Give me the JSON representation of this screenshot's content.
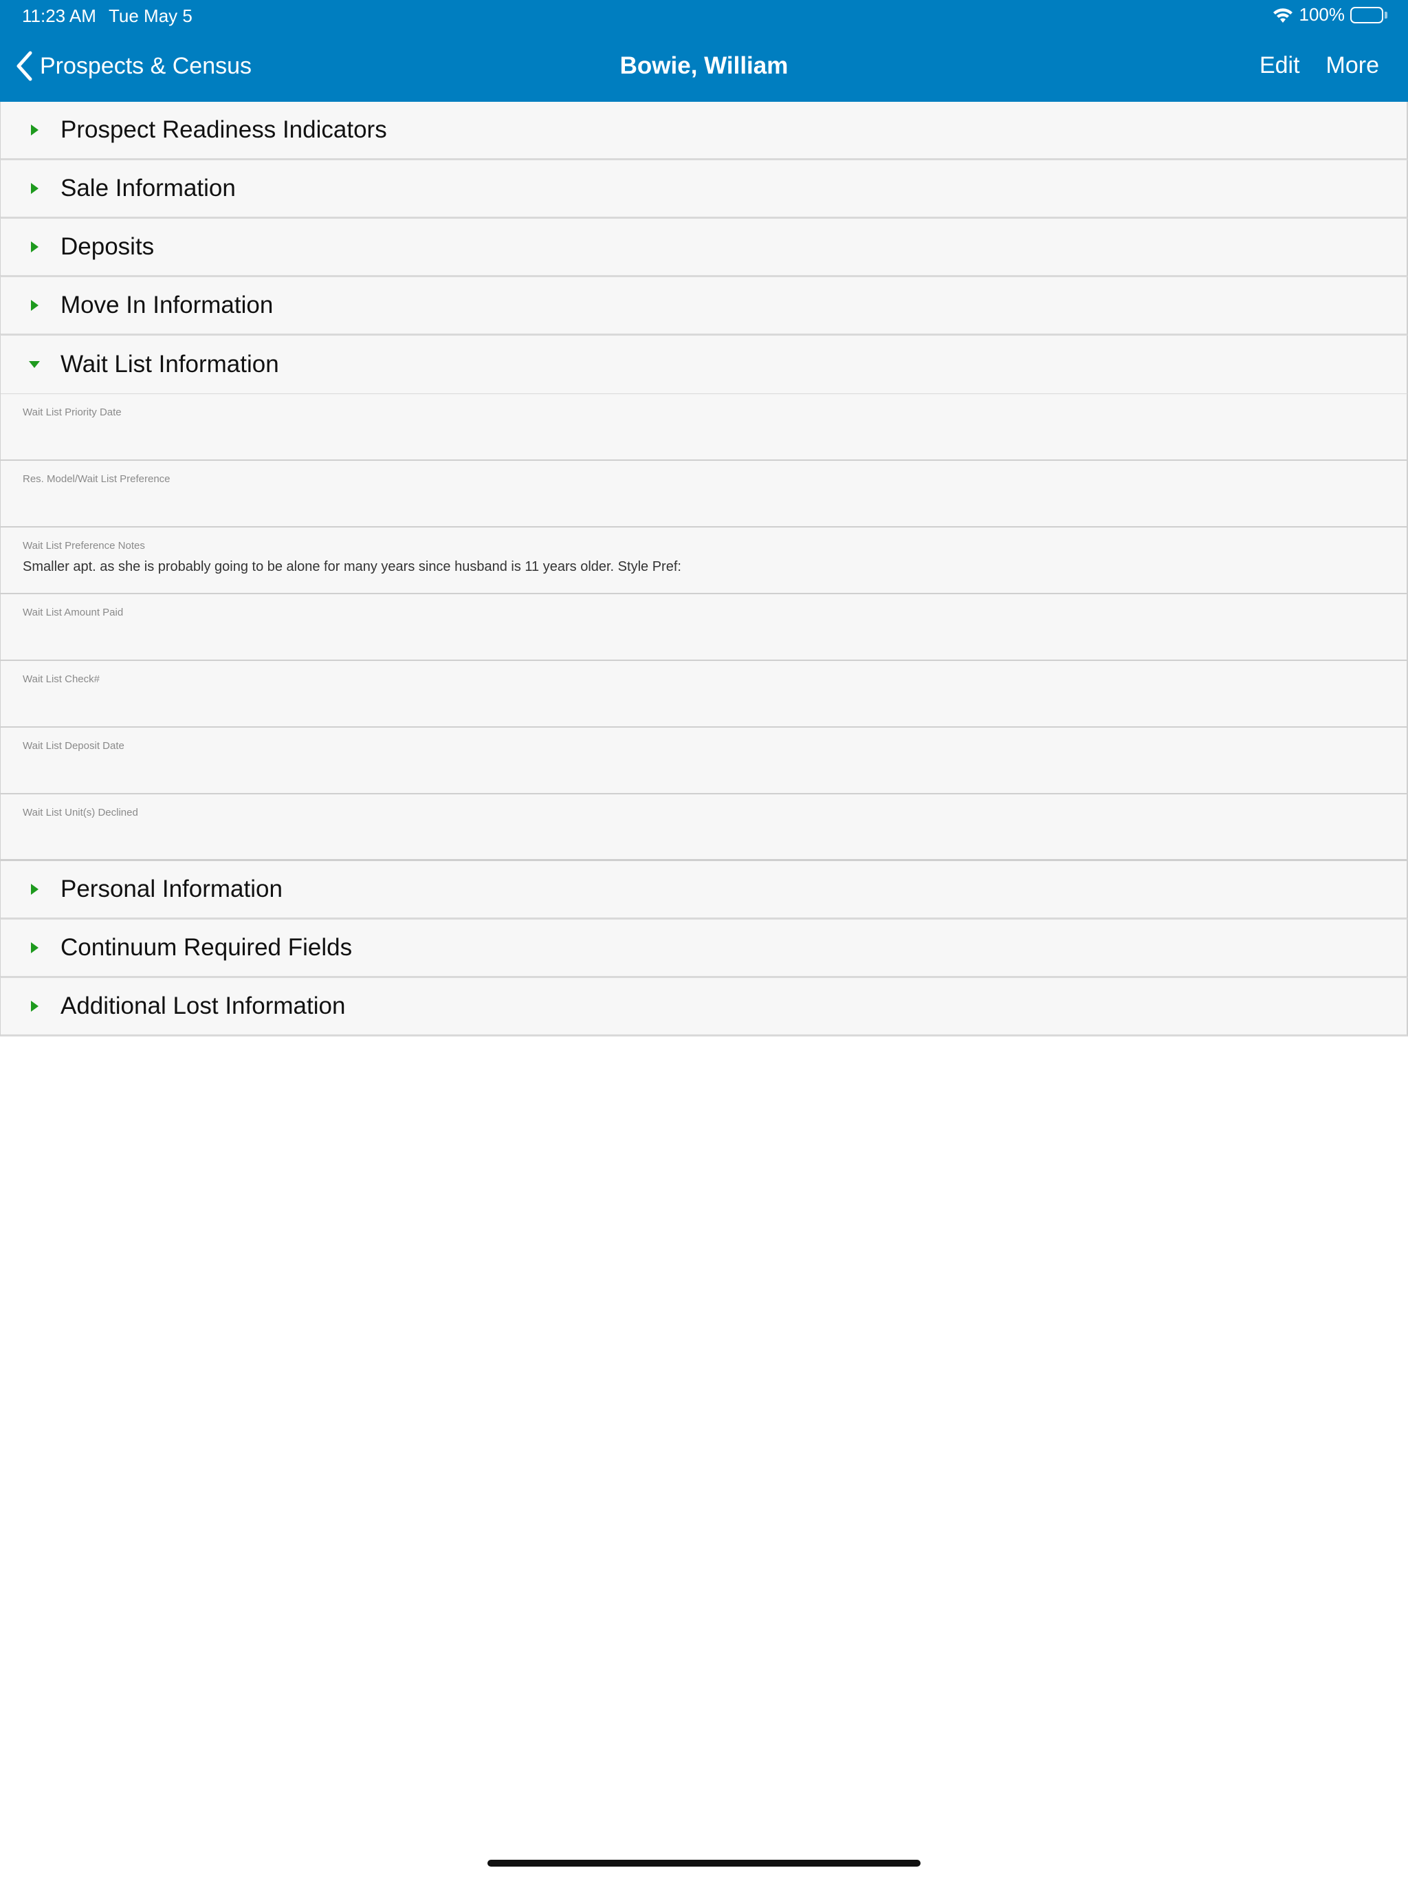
{
  "status_bar": {
    "time": "11:23 AM",
    "date": "Tue May 5",
    "battery": "100%"
  },
  "nav": {
    "back_label": "Prospects & Census",
    "title": "Bowie, William",
    "edit_label": "Edit",
    "more_label": "More"
  },
  "colors": {
    "brand": "#007ec0",
    "caret": "#1e9a1e"
  },
  "sections_top": [
    {
      "title": "Prospect Readiness Indicators",
      "expanded": false
    },
    {
      "title": "Sale Information",
      "expanded": false
    },
    {
      "title": "Deposits",
      "expanded": false
    },
    {
      "title": "Move In Information",
      "expanded": false
    },
    {
      "title": "Wait List Information",
      "expanded": true
    }
  ],
  "wait_list_fields": [
    {
      "label": "Wait List Priority Date",
      "value": ""
    },
    {
      "label": "Res. Model/Wait List Preference",
      "value": ""
    },
    {
      "label": "Wait List Preference Notes",
      "value": "Smaller apt. as she is probably going to be alone for many years since husband is 11 years older. Style Pref:"
    },
    {
      "label": "Wait List Amount Paid",
      "value": ""
    },
    {
      "label": "Wait List Check#",
      "value": ""
    },
    {
      "label": "Wait List Deposit Date",
      "value": ""
    },
    {
      "label": "Wait List Unit(s) Declined",
      "value": ""
    }
  ],
  "sections_bottom": [
    {
      "title": "Personal Information",
      "expanded": false
    },
    {
      "title": "Continuum Required Fields",
      "expanded": false
    },
    {
      "title": "Additional Lost Information",
      "expanded": false
    }
  ]
}
